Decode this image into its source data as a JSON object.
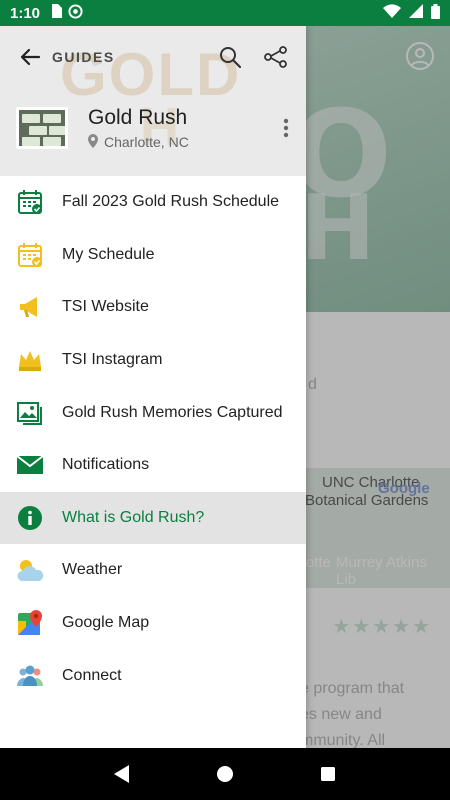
{
  "status_bar": {
    "time": "1:10",
    "icons_left": [
      "sd-card-icon",
      "at-sign-icon"
    ],
    "icons_right": [
      "wifi-icon",
      "signal-icon",
      "battery-icon"
    ]
  },
  "background": {
    "snippets": {
      "d": "d",
      "map_unc": "UNC Charlotte",
      "map_botanical": "Botanical Gardens",
      "map_google": "Google",
      "map_murrey": "Murrey Atkins Lib",
      "map_otte": "otte",
      "desc_line1": "e program that",
      "desc_line2": "es new and",
      "desc_line3": "mmunity. All"
    }
  },
  "drawer": {
    "header": {
      "section_label": "GUIDES",
      "guide_title": "Gold Rush",
      "guide_location": "Charlotte, NC"
    },
    "menu": [
      {
        "label": "Fall 2023 Gold Rush Schedule",
        "icon": "calendar-check-icon",
        "color": "#0a7f40",
        "active": false
      },
      {
        "label": "My Schedule",
        "icon": "calendar-check-icon",
        "color": "#f2c01e",
        "active": false
      },
      {
        "label": "TSI Website",
        "icon": "megaphone-icon",
        "color": "#f2c01e",
        "active": false
      },
      {
        "label": "TSI Instagram",
        "icon": "crown-icon",
        "color": "#f2c01e",
        "active": false
      },
      {
        "label": "Gold Rush Memories Captured",
        "icon": "photos-icon",
        "color": "#0a7f40",
        "active": false
      },
      {
        "label": "Notifications",
        "icon": "envelope-icon",
        "color": "#0a7f40",
        "active": false
      },
      {
        "label": "What is Gold Rush?",
        "icon": "info-icon",
        "color": "#0a7f40",
        "active": true
      },
      {
        "label": "Weather",
        "icon": "weather-icon",
        "color": "#f2c01e",
        "active": false
      },
      {
        "label": "Google Map",
        "icon": "google-maps-icon",
        "color": "#34a853",
        "active": false
      },
      {
        "label": "Connect",
        "icon": "people-icon",
        "color": "#7bb3d8",
        "active": false
      }
    ]
  },
  "colors": {
    "brand_green": "#0a7f40",
    "accent_gold": "#f2c01e",
    "active_bg": "#e3e3e3"
  }
}
